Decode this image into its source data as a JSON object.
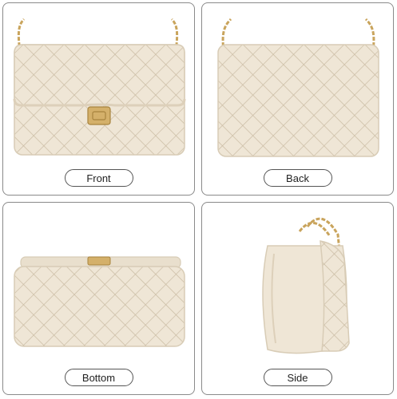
{
  "views": [
    {
      "id": "front",
      "label": "Front"
    },
    {
      "id": "back",
      "label": "Back"
    },
    {
      "id": "bottom",
      "label": "Bottom"
    },
    {
      "id": "side",
      "label": "Side"
    }
  ],
  "colors": {
    "leather": "#efe6d6",
    "leather_shade": "#ddd0ba",
    "quilt_line": "#cbbda5",
    "gold": "#c9a45c",
    "border": "#8a8a8a"
  }
}
